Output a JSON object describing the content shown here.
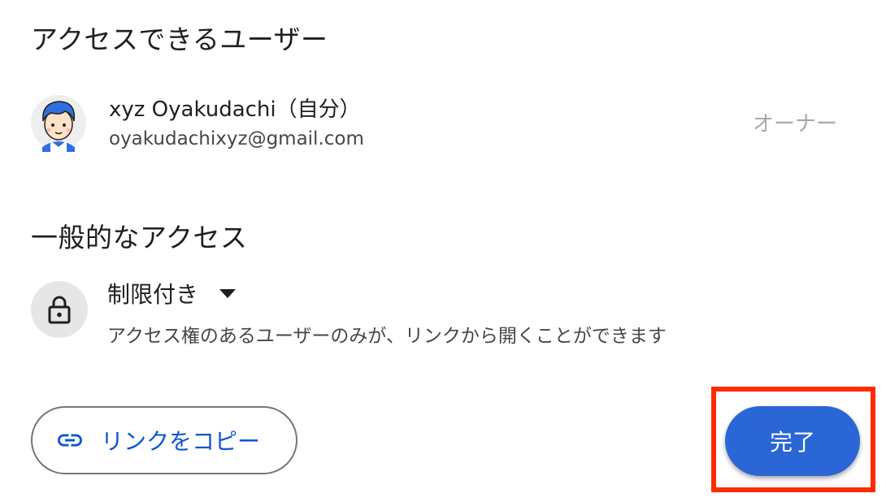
{
  "people_section": {
    "title": "アクセスできるユーザー",
    "users": [
      {
        "name": "xyz Oyakudachi（自分）",
        "email": "oyakudachixyz@gmail.com",
        "role": "オーナー",
        "avatar_icon": "user-avatar-icon"
      }
    ]
  },
  "general_access": {
    "title": "一般的なアクセス",
    "icon": "lock-icon",
    "selected_option": "制限付き",
    "description": "アクセス権のあるユーザーのみが、リンクから開くことができます"
  },
  "footer": {
    "copy_link_label": "リンクをコピー",
    "copy_link_icon": "link-icon",
    "done_label": "完了"
  },
  "colors": {
    "primary_blue": "#0b57d0",
    "done_button_bg": "#2a66d6",
    "highlight_red": "#ff2a00",
    "muted_text": "#a8a8a8"
  }
}
